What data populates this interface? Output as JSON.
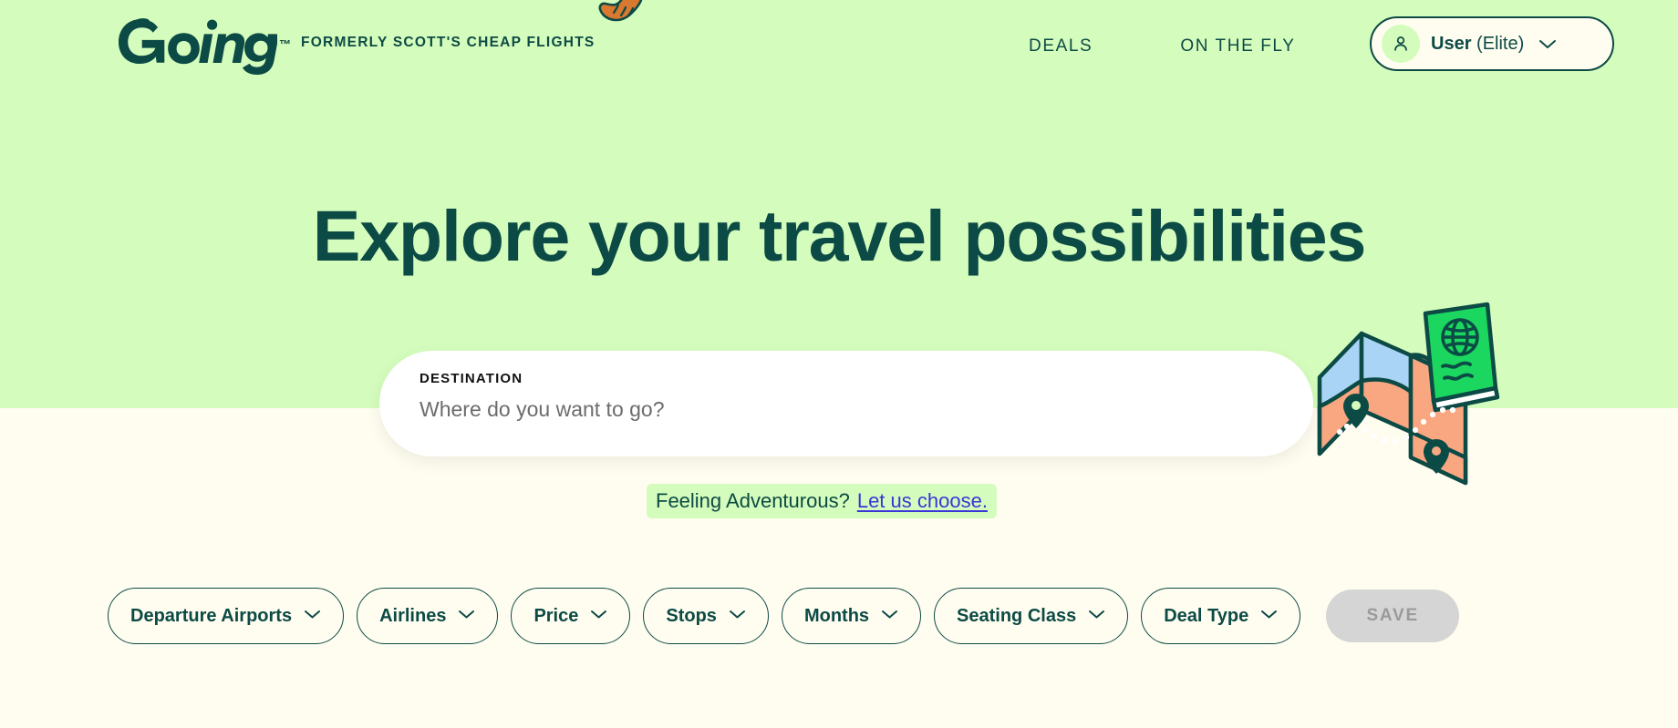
{
  "brand": {
    "logo_text": "Going",
    "trademark": "™",
    "tagline": "FORMERLY SCOTT'S CHEAP FLIGHTS"
  },
  "nav": {
    "items": [
      {
        "label": "DEALS",
        "name": "nav-deals"
      },
      {
        "label": "ON THE FLY",
        "name": "nav-on-the-fly"
      }
    ]
  },
  "account": {
    "name": "User",
    "tier": "(Elite)",
    "avatar_icon": "person-icon",
    "chevron_icon": "chevron-down-icon"
  },
  "hero": {
    "headline": "Explore your travel possibilities"
  },
  "search": {
    "label": "DESTINATION",
    "placeholder": "Where do you want to go?",
    "value": ""
  },
  "adventurous": {
    "prompt": "Feeling Adventurous?",
    "link": "Let us choose."
  },
  "filters": {
    "pills": [
      {
        "label": "Departure Airports",
        "name": "filter-departure-airports"
      },
      {
        "label": "Airlines",
        "name": "filter-airlines"
      },
      {
        "label": "Price",
        "name": "filter-price"
      },
      {
        "label": "Stops",
        "name": "filter-stops"
      },
      {
        "label": "Months",
        "name": "filter-months"
      },
      {
        "label": "Seating Class",
        "name": "filter-seating-class"
      },
      {
        "label": "Deal Type",
        "name": "filter-deal-type"
      }
    ],
    "save_label": "SAVE",
    "save_disabled": true
  },
  "illustrations": {
    "hand": "pointing-hand-icon",
    "map": "folded-map-passport-illustration"
  },
  "colors": {
    "hero_background": "#D4FCBC",
    "page_background": "#FFFDF0",
    "brand_dark": "#0C4A45",
    "link": "#3A35D8",
    "save_disabled_bg": "#D5D5D5",
    "passport_green": "#1BD760",
    "map_blue": "#A9D4F5",
    "map_orange": "#F9A781"
  }
}
